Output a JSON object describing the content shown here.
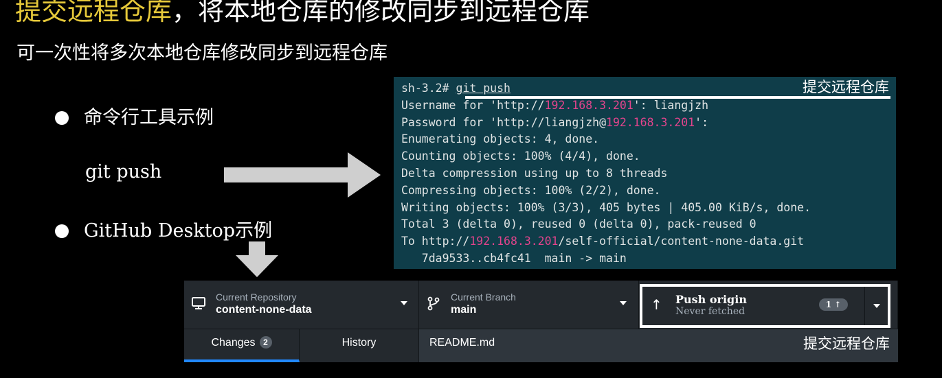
{
  "slide": {
    "title_highlight": "提交远程仓库",
    "title_rest": "，将本地仓库的修改同步到远程仓库",
    "subtitle": "可一次性将多次本地仓库修改同步到远程仓库",
    "bullet_cli": "命令行工具示例",
    "cli_command": "git push",
    "bullet_gh": "GitHub Desktop示例"
  },
  "terminal": {
    "annotation": "提交远程仓库",
    "prompt": "sh-3.2# ",
    "command": "git push",
    "l2a": "Username for 'http://",
    "l2host": "192.168.3.201",
    "l2b": "': liangjzh",
    "l3a": "Password for 'http://liangjzh@",
    "l3host": "192.168.3.201",
    "l3b": "':",
    "l4": "Enumerating objects: 4, done.",
    "l5": "Counting objects: 100% (4/4), done.",
    "l6": "Delta compression using up to 8 threads",
    "l7": "Compressing objects: 100% (2/2), done.",
    "l8": "Writing objects: 100% (3/3), 405 bytes | 405.00 KiB/s, done.",
    "l9": "Total 3 (delta 0), reused 0 (delta 0), pack-reused 0",
    "l10a": "To http://",
    "l10host": "192.168.3.201",
    "l10b": "/self-official/content-none-data.git",
    "l11": "   7da9533..cb4fc41  main -> main"
  },
  "github_desktop": {
    "repo_label": "Current Repository",
    "repo_name": "content-none-data",
    "branch_label": "Current Branch",
    "branch_name": "main",
    "push_title": "Push origin",
    "push_sub": "Never fetched",
    "push_badge": "1 ↑",
    "tab_changes": "Changes",
    "tab_changes_count": "2",
    "tab_history": "History",
    "file_name": "README.md",
    "annotation": "提交远程仓库"
  },
  "colors": {
    "title_highlight": "#e6c93a",
    "terminal_bg": "#0f3d49",
    "terminal_host": "#e2448c",
    "gh_bg": "#24292e",
    "gh_tab_accent": "#2188ff"
  },
  "icons": [
    "monitor-icon",
    "branch-icon",
    "arrow-up-icon",
    "chevron-down-icon",
    "arrow-right-shape",
    "arrow-down-shape"
  ]
}
